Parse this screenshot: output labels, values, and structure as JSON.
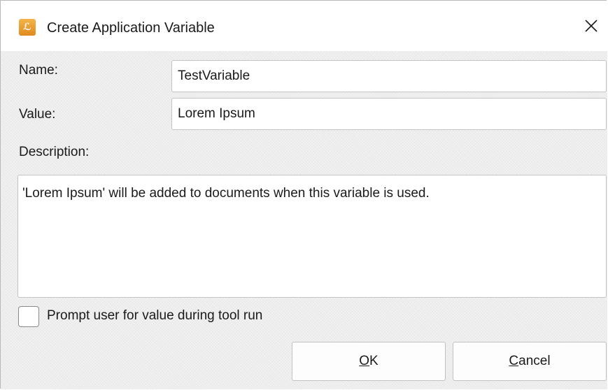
{
  "dialog": {
    "title": "Create Application Variable",
    "icon": "app-logo-icon",
    "icon_glyph": "ℒ",
    "close_glyph": "✕"
  },
  "form": {
    "name_label": "Name:",
    "name_value": "TestVariable",
    "value_label": "Value:",
    "value_value": "Lorem Ipsum",
    "description_label": "Description:",
    "description_value": "'Lorem Ipsum' will be added to documents when this variable is used.",
    "prompt_checkbox_label": "Prompt user for value during tool run",
    "prompt_checked": false
  },
  "buttons": {
    "ok_mnemonic": "O",
    "ok_rest": "K",
    "cancel_mnemonic": "C",
    "cancel_rest": "ancel"
  },
  "colors": {
    "icon_accent": "#e08a1e",
    "dialog_background": "#ededed"
  }
}
